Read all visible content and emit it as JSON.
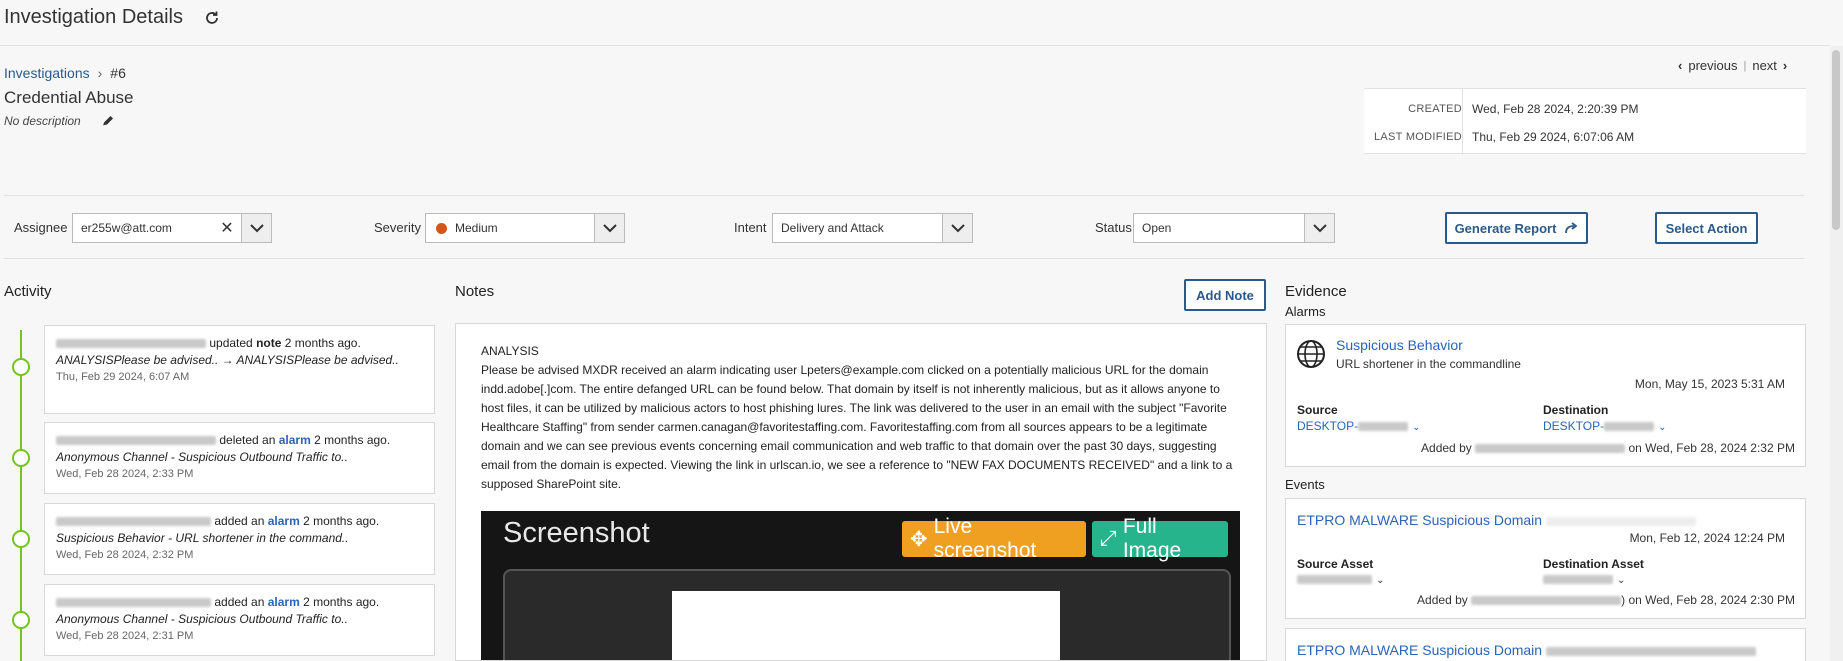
{
  "header": {
    "title": "Investigation Details"
  },
  "breadcrumb": {
    "parent": "Investigations",
    "current": "#6"
  },
  "investigation": {
    "title": "Credential Abuse",
    "description": "No description"
  },
  "pager": {
    "previous": "previous",
    "next": "next"
  },
  "meta": {
    "created_label": "CREATED",
    "created": "Wed, Feb 28 2024, 2:20:39 PM",
    "modified_label": "LAST MODIFIED",
    "modified": "Thu, Feb 29 2024, 6:07:06 AM"
  },
  "fields": {
    "assignee_label": "Assignee",
    "assignee": "er255w@att.com",
    "severity_label": "Severity",
    "severity": "Medium",
    "severity_color": "#d4561b",
    "intent_label": "Intent",
    "intent": "Delivery and Attack",
    "status_label": "Status",
    "status": "Open",
    "generate_report": "Generate Report",
    "select_action": "Select Action"
  },
  "activity": {
    "title": "Activity",
    "items": [
      {
        "action": "updated",
        "object": "note",
        "ago": "2 months ago.",
        "detail": "ANALYSISPlease be advised.. → ANALYSISPlease be advised..",
        "time": "Thu, Feb 29 2024, 6:07 AM"
      },
      {
        "action": "deleted an",
        "object": "alarm",
        "ago": "2 months ago.",
        "detail": "Anonymous Channel - Suspicious Outbound Traffic to..",
        "time": "Wed, Feb 28 2024, 2:33 PM"
      },
      {
        "action": "added an",
        "object": "alarm",
        "ago": "2 months ago.",
        "detail": "Suspicious Behavior - URL shortener in the command..",
        "time": "Wed, Feb 28 2024, 2:32 PM"
      },
      {
        "action": "added an",
        "object": "alarm",
        "ago": "2 months ago.",
        "detail": "Anonymous Channel - Suspicious Outbound Traffic to..",
        "time": "Wed, Feb 28 2024, 2:31 PM"
      }
    ]
  },
  "notes": {
    "title": "Notes",
    "add_note": "Add Note",
    "heading": "ANALYSIS",
    "body": "Please be advised MXDR received an alarm indicating user Lpeters@example.com clicked on a potentially malicious URL for the domain indd.adobe[.]com. The entire defanged URL can be found below. That domain by itself is not inherently malicious, but as it allows anyone to host files, it can be utilized by malicious actors to host phishing lures. The link was delivered to the user in an email with the subject \"Favorite Healthcare Staffing\" from sender carmen.canagan@favoritestaffing.com. Favoritestaffing.com from all sources appears to be a legitimate domain and we can see previous events concerning email communication and web traffic to that domain over the past 30 days, suggesting email from the domain is expected. Viewing the link in urlscan.io, we see a reference to \"NEW FAX DOCUMENTS RECEIVED\" and a link to a supposed SharePoint site.",
    "screenshot_title": "Screenshot",
    "live_screenshot": "Live screenshot",
    "full_image": "Full Image"
  },
  "evidence": {
    "title": "Evidence",
    "alarms_label": "Alarms",
    "alarm": {
      "name": "Suspicious Behavior",
      "desc": "URL shortener in the commandline",
      "time": "Mon, May 15, 2023 5:31 AM",
      "source_label": "Source",
      "source": "DESKTOP-",
      "dest_label": "Destination",
      "dest": "DESKTOP-",
      "added_prefix": "Added by",
      "added_suffix": "on Wed, Feb 28, 2024 2:32 PM"
    },
    "events_label": "Events",
    "event1": {
      "name": "ETPRO MALWARE Suspicious Domain",
      "time": "Mon, Feb 12, 2024 12:24 PM",
      "source_label": "Source Asset",
      "dest_label": "Destination Asset",
      "added_prefix": "Added by",
      "added_suffix": ") on Wed, Feb 28, 2024 2:30 PM"
    },
    "event2": {
      "name": "ETPRO MALWARE Suspicious Domain"
    }
  },
  "colors": {
    "accent": "#2a5a8c",
    "link": "#2a64b5",
    "timeline": "#74c41c",
    "live_btn": "#f0a020",
    "full_btn": "#26b48c"
  }
}
